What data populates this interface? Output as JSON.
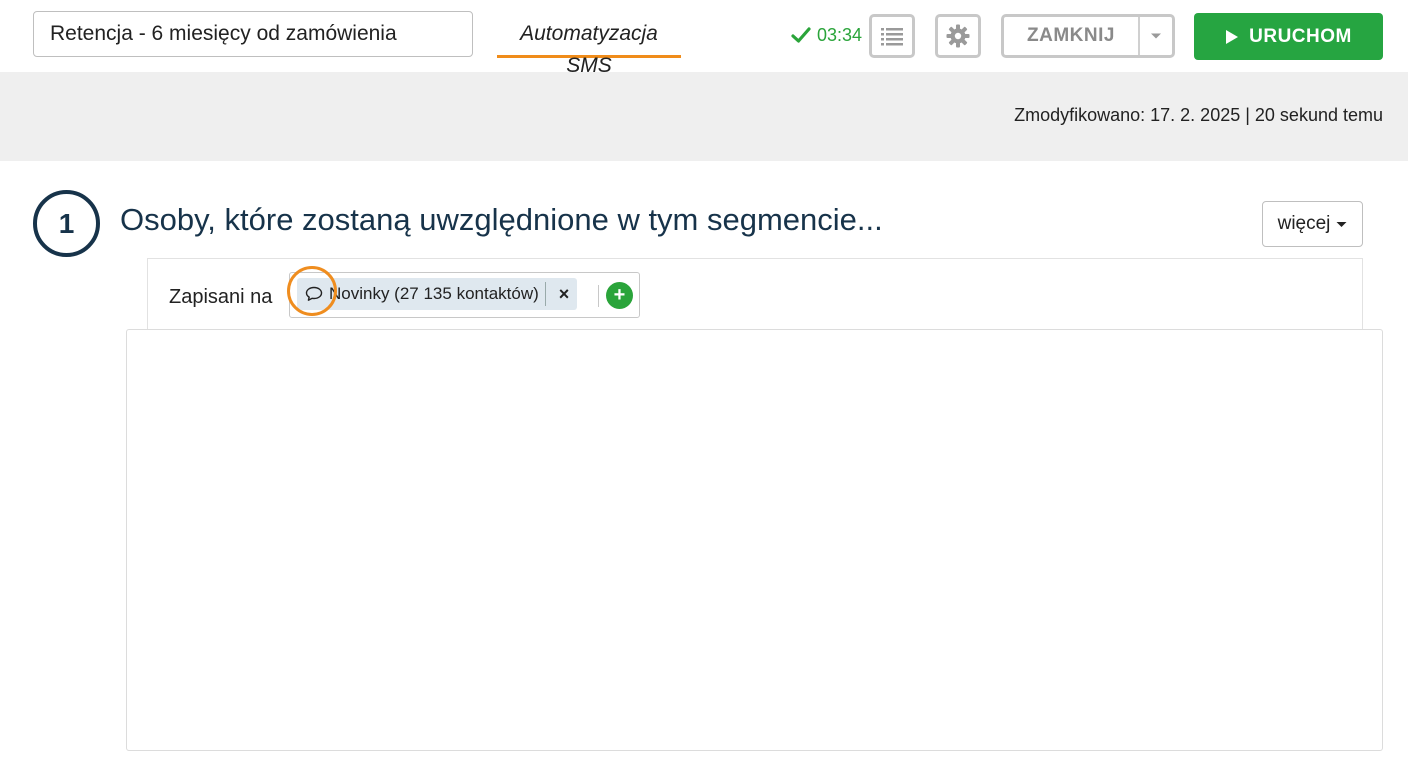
{
  "header": {
    "segment_name": "Retencja - 6 miesięcy od zamówienia",
    "tab_label": "Automatyzacja SMS",
    "saved_time": "03:34",
    "close_label": "ZAMKNIJ",
    "run_label": "URUCHOM",
    "accent_color": "#f08c1a",
    "run_color": "#26a541"
  },
  "info": {
    "modified": "Zmodyfikowano: 17. 2. 2025 | 20 sekund temu"
  },
  "step": {
    "number": "1",
    "title": "Osoby, które zostaną uwzględnione w tym segmencie...",
    "more_label": "więcej"
  },
  "condition": {
    "label": "Zapisani na",
    "tag_icon": "speech-bubble-icon",
    "tag_label": "Novinky (27 135 kontaktów)",
    "remove_symbol": "×",
    "add_symbol": "+"
  }
}
